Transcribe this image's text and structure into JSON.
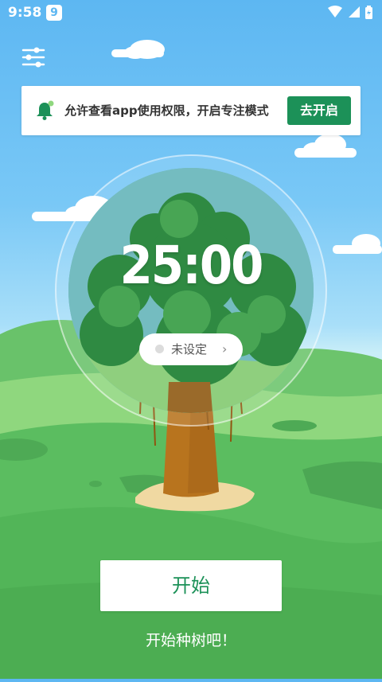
{
  "status_bar": {
    "time": "9:58",
    "notification_badge": "9",
    "icons": [
      "wifi-icon",
      "signal-icon",
      "battery-charging-icon"
    ]
  },
  "header": {
    "menu_icon": "settings-sliders-icon"
  },
  "banner": {
    "icon": "bell-icon",
    "message": "允许查看app使用权限，开启专注模式",
    "button_label": "去开启",
    "button_color": "#1c9158"
  },
  "timer": {
    "display": "25:00",
    "tag_label": "未设定",
    "tag_chevron": "›"
  },
  "actions": {
    "start_label": "开始",
    "hint": "开始种树吧！"
  },
  "colors": {
    "sky_top": "#5db7f2",
    "grass": "#5bbd60",
    "accent_green": "#1c9158"
  }
}
